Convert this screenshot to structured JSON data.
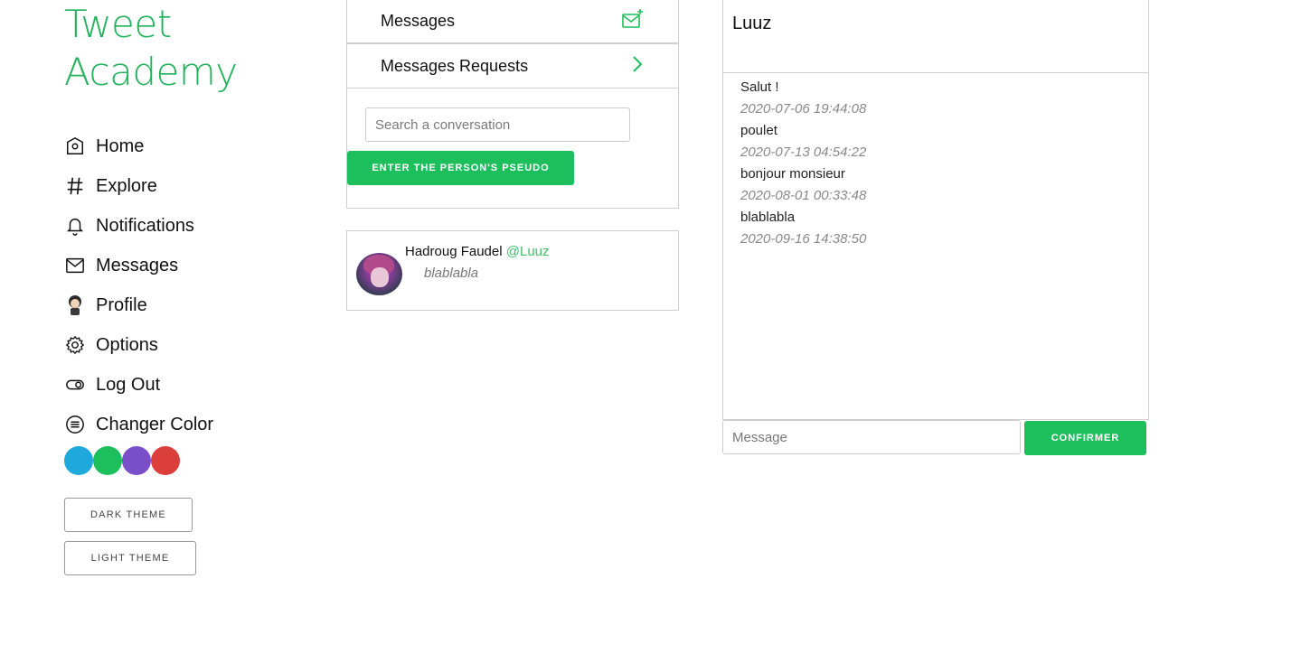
{
  "brand": {
    "line1": "Tweet",
    "line2": "Academy",
    "color": "#22b25b"
  },
  "nav": {
    "items": [
      {
        "label": "Home",
        "icon": "home-icon"
      },
      {
        "label": "Explore",
        "icon": "hash-icon"
      },
      {
        "label": "Notifications",
        "icon": "bell-icon"
      },
      {
        "label": "Messages",
        "icon": "mail-icon"
      },
      {
        "label": "Profile",
        "icon": "profile-avatar-icon"
      },
      {
        "label": "Options",
        "icon": "gear-icon"
      },
      {
        "label": "Log Out",
        "icon": "toggle-icon"
      },
      {
        "label": "Changer Color",
        "icon": "menu-circle-icon"
      }
    ]
  },
  "color_swatches": [
    "#1fa8dc",
    "#1dbf5d",
    "#7b4fc9",
    "#db3f3c"
  ],
  "themes": {
    "dark_label": "DARK THEME",
    "light_label": "LIGHT THEME"
  },
  "messages_panel": {
    "title": "Messages",
    "requests_label": "Messages Requests",
    "search_placeholder": "Search a conversation",
    "pseudo_button": "ENTER THE PERSON'S PSEUDO"
  },
  "conversation": {
    "name": "Hadroug Faudel",
    "handle": "@Luuz",
    "last_message": "blablabla"
  },
  "chat": {
    "title": "Luuz",
    "messages": [
      {
        "text": "Salut !",
        "time": "2020-07-06 19:44:08"
      },
      {
        "text": "poulet",
        "time": "2020-07-13 04:54:22"
      },
      {
        "text": "bonjour monsieur",
        "time": "2020-08-01 00:33:48"
      },
      {
        "text": "blablabla",
        "time": "2020-09-16 14:38:50"
      }
    ],
    "input_placeholder": "Message",
    "confirm_label": "CONFIRMER"
  },
  "accent_color": "#1dbf5d"
}
